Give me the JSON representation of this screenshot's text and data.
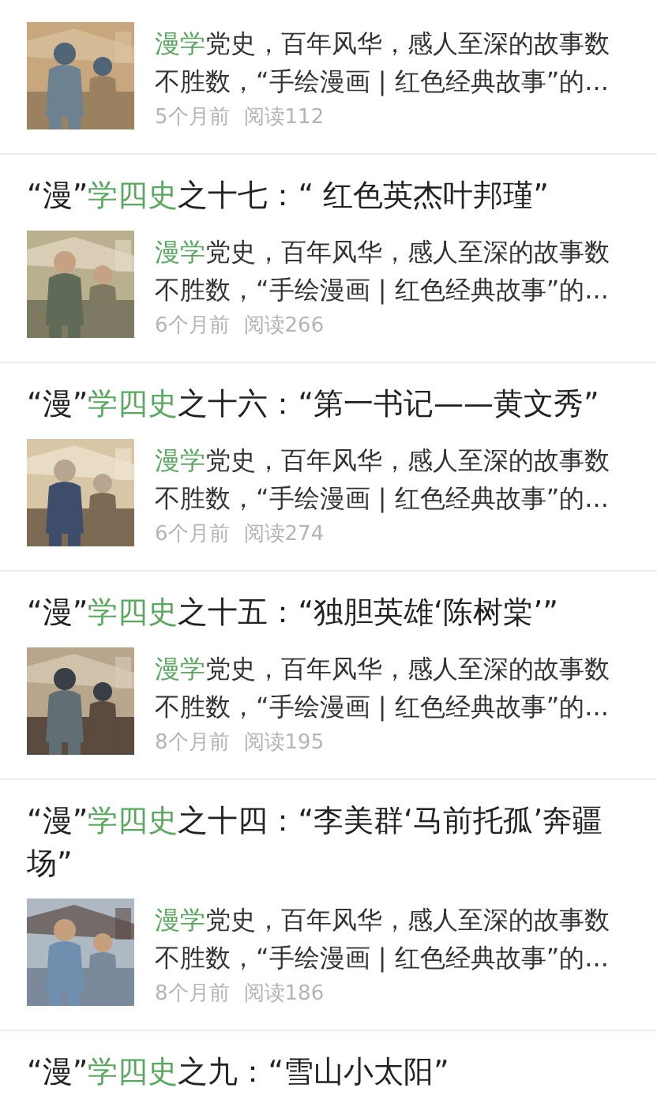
{
  "articles": [
    {
      "summary": [
        {
          "text": "漫学",
          "highlight": true
        },
        {
          "text": "党史，百年风华，感人至深的故事数不胜数，“手绘漫画 | 红色经典故事”的...",
          "highlight": false
        }
      ],
      "age": "5个月前",
      "reads": "阅读112",
      "picture": {
        "kind": "picture"
      }
    },
    {
      "title": [
        {
          "text": "“漫”",
          "highlight": false
        },
        {
          "text": "学四史",
          "highlight": true
        },
        {
          "text": "之十七：“ 红色英杰叶邦瑾”",
          "highlight": false
        }
      ],
      "summary": [
        {
          "text": "漫学",
          "highlight": true
        },
        {
          "text": "党史，百年风华，感人至深的故事数不胜数，“手绘漫画 | 红色经典故事”的...",
          "highlight": false
        }
      ],
      "age": "6个月前",
      "reads": "阅读266",
      "picture": {
        "kind": "picture"
      }
    },
    {
      "title": [
        {
          "text": "“漫”",
          "highlight": false
        },
        {
          "text": "学四史",
          "highlight": true
        },
        {
          "text": "之十六：“第一书记——黄文秀”",
          "highlight": false
        }
      ],
      "summary": [
        {
          "text": "漫学",
          "highlight": true
        },
        {
          "text": "党史，百年风华，感人至深的故事数不胜数，“手绘漫画 | 红色经典故事”的...",
          "highlight": false
        }
      ],
      "age": "6个月前",
      "reads": "阅读274",
      "picture": {
        "kind": "picture"
      }
    },
    {
      "title": [
        {
          "text": "“漫”",
          "highlight": false
        },
        {
          "text": "学四史",
          "highlight": true
        },
        {
          "text": "之十五：“独胆英雄‘陈树棠’”",
          "highlight": false
        }
      ],
      "summary": [
        {
          "text": "漫学",
          "highlight": true
        },
        {
          "text": "党史，百年风华，感人至深的故事数不胜数，“手绘漫画 | 红色经典故事”的...",
          "highlight": false
        }
      ],
      "age": "8个月前",
      "reads": "阅读195",
      "picture": {
        "kind": "picture"
      }
    },
    {
      "title": [
        {
          "text": "“漫”",
          "highlight": false
        },
        {
          "text": "学四史",
          "highlight": true
        },
        {
          "text": "之十四：“李美群‘马前托孤’奔疆场”",
          "highlight": false
        }
      ],
      "summary": [
        {
          "text": "漫学",
          "highlight": true
        },
        {
          "text": "党史，百年风华，感人至深的故事数不胜数，“手绘漫画 | 红色经典故事”的...",
          "highlight": false
        }
      ],
      "age": "8个月前",
      "reads": "阅读186",
      "picture": {
        "kind": "picture"
      }
    },
    {
      "title": [
        {
          "text": "“漫”",
          "highlight": false
        },
        {
          "text": "学四史",
          "highlight": true
        },
        {
          "text": "之九：“雪山小太阳”",
          "highlight": false
        }
      ]
    }
  ]
}
